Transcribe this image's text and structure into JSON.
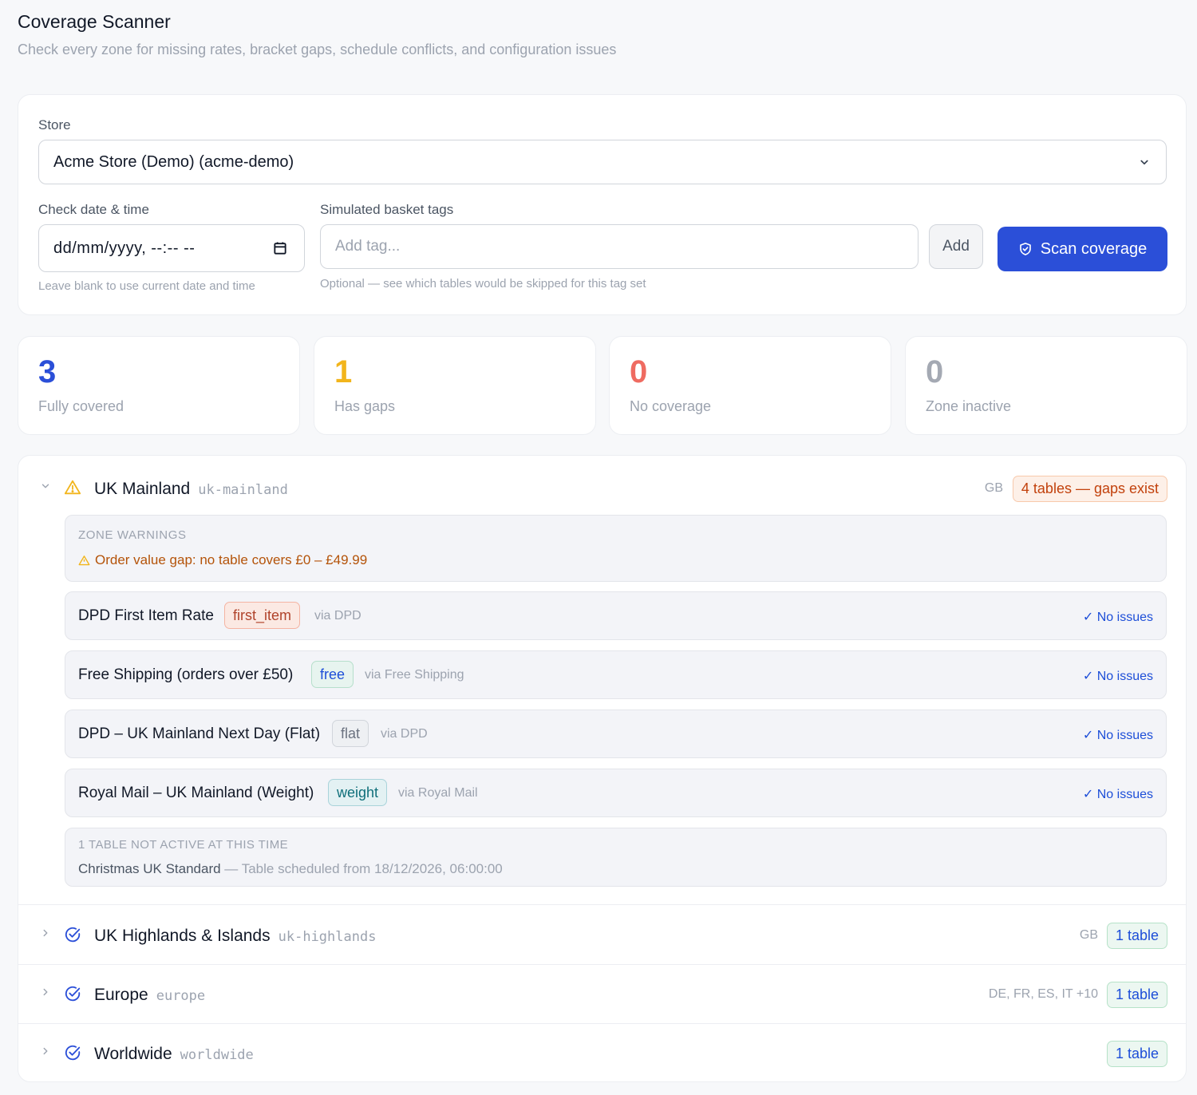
{
  "header": {
    "title": "Coverage Scanner",
    "subtitle": "Check every zone for missing rates, bracket gaps, schedule conflicts, and configuration issues"
  },
  "form": {
    "store_label": "Store",
    "store_value": "Acme Store (Demo) (acme-demo)",
    "date_label": "Check date & time",
    "date_value": "dd/mm/yyyy, --:-- --",
    "date_hint": "Leave blank to use current date and time",
    "tags_label": "Simulated basket tags",
    "tags_placeholder": "Add tag...",
    "tags_hint": "Optional — see which tables would be skipped for this tag set",
    "add_label": "Add",
    "scan_label": "Scan coverage"
  },
  "stats": [
    {
      "value": "3",
      "label": "Fully covered",
      "color": "#2b4fd8"
    },
    {
      "value": "1",
      "label": "Has gaps",
      "color": "#f2b51c"
    },
    {
      "value": "0",
      "label": "No coverage",
      "color": "#ef6b61"
    },
    {
      "value": "0",
      "label": "Zone inactive",
      "color": "#a4a9b3"
    }
  ],
  "zones": {
    "uk_mainland": {
      "name": "UK Mainland",
      "slug": "uk-mainland",
      "countries": "GB",
      "summary": "4 tables — gaps exist",
      "warnings_title": "ZONE WARNINGS",
      "warning": "Order value gap: no table covers £0 – £49.99",
      "tables": [
        {
          "name": "DPD First Item Rate",
          "tag": "first_item",
          "via": "via DPD",
          "status": "✓ No issues"
        },
        {
          "name": "Free Shipping (orders over £50)",
          "tag": "free",
          "via": "via Free Shipping",
          "status": "✓ No issues"
        },
        {
          "name": "DPD – UK Mainland Next Day (Flat)",
          "tag": "flat",
          "via": "via DPD",
          "status": "✓ No issues"
        },
        {
          "name": "Royal Mail – UK Mainland (Weight)",
          "tag": "weight",
          "via": "via Royal Mail",
          "status": "✓ No issues"
        }
      ],
      "inactive_title": "1 TABLE NOT ACTIVE AT THIS TIME",
      "inactive_name": "Christmas UK Standard",
      "inactive_desc": " — Table scheduled from 18/12/2026, 06:00:00"
    },
    "uk_highlands": {
      "name": "UK Highlands & Islands",
      "slug": "uk-highlands",
      "countries": "GB",
      "summary": "1 table"
    },
    "europe": {
      "name": "Europe",
      "slug": "europe",
      "countries": "DE, FR, ES, IT +10",
      "summary": "1 table"
    },
    "worldwide": {
      "name": "Worldwide",
      "slug": "worldwide",
      "countries": "",
      "summary": "1 table"
    }
  },
  "icons": {
    "warning": "warning-triangle-icon",
    "check": "check-circle-icon",
    "shield": "shield-check-icon",
    "calendar": "calendar-icon"
  }
}
